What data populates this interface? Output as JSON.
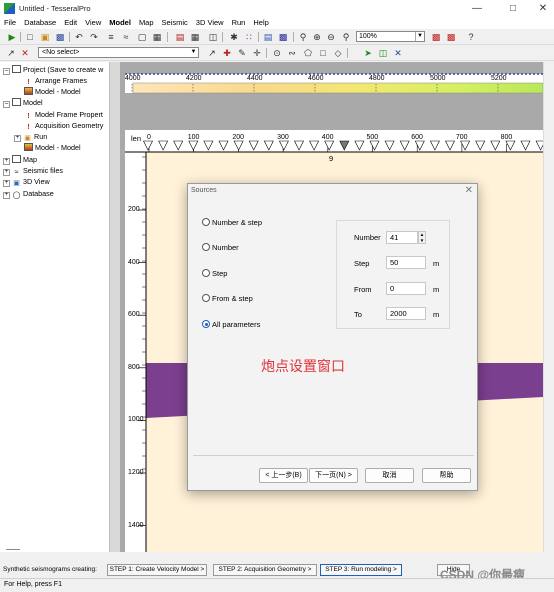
{
  "window": {
    "title": "Untitled - TesseralPro"
  },
  "menu": [
    "File",
    "Database",
    "Edit",
    "View",
    "Model",
    "Map",
    "Seismic",
    "3D View",
    "Run",
    "Help"
  ],
  "toolbar": {
    "selection_value": "<No select>",
    "zoom_value": "100%"
  },
  "tree": {
    "project": "Project (Save to create w",
    "arrange_frames": "Arrange Frames",
    "model_model_1": "Model - Model",
    "model": "Model",
    "model_frame_props": "Model Frame Propert",
    "acq_geometry": "Acquisition Geometry",
    "run": "Run",
    "model_model_2": "Model - Model",
    "map": "Map",
    "seismic_files": "Seismic files",
    "view3d": "3D View",
    "database": "Database"
  },
  "view": {
    "velocity_ticks": [
      "4000",
      "4200",
      "4400",
      "4600",
      "4800",
      "5000",
      "5200"
    ],
    "len_label": "len",
    "x_ticks": [
      "0",
      "100",
      "200",
      "300",
      "400",
      "500",
      "600",
      "700",
      "800"
    ],
    "marker_label": "9",
    "depth_ticks": [
      "200",
      "400",
      "600",
      "800",
      "1000",
      "1200",
      "1400"
    ],
    "colors": {
      "layer_bg": "#fff2d9",
      "layer_purple": "#7b3f8f",
      "grey_block": "#a9a9a9"
    }
  },
  "dialog": {
    "title": "Sources",
    "options": [
      "Number & step",
      "Number",
      "Step",
      "From & step",
      "All parameters"
    ],
    "selected_option": "All parameters",
    "params": {
      "number_label": "Number",
      "number_value": "41",
      "step_label": "Step",
      "step_value": "50",
      "step_unit": "m",
      "from_label": "From",
      "from_value": "0",
      "from_unit": "m",
      "to_label": "To",
      "to_value": "2000",
      "to_unit": "m"
    },
    "caption": "炮点设置窗口",
    "buttons": {
      "back": "< 上一步(B)",
      "next": "下一页(N) >",
      "cancel": "取消",
      "help": "帮助"
    }
  },
  "steps": {
    "label": "Synthetic seismograms creating:",
    "step1": "STEP 1: Create Velocity Model >",
    "step2": "STEP 2: Acquisition Geometry >",
    "step3": "STEP 3: Run modeling >",
    "hide": "Hide"
  },
  "status": {
    "text": "For Help, press F1"
  },
  "watermark": "CSDN @你最瘦"
}
